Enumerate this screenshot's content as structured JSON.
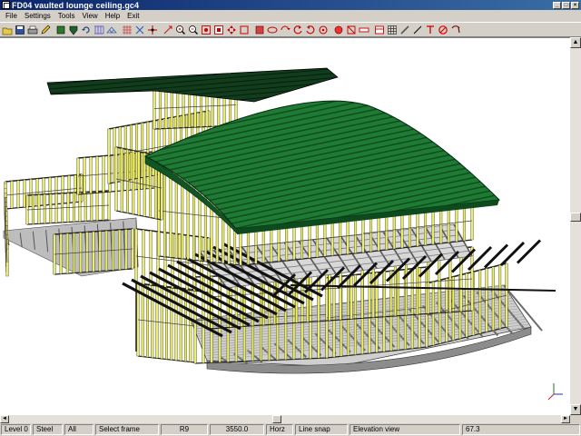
{
  "window": {
    "title": "FD04 vaulted lounge ceiling.gc4",
    "buttons": {
      "minimize": "_",
      "maximize": "□",
      "close": "×"
    }
  },
  "menu": [
    "File",
    "Settings",
    "Tools",
    "View",
    "Help",
    "Exit"
  ],
  "toolbar": {
    "icons": [
      "open-folder-icon",
      "save-icon",
      "print-icon",
      "pencil-icon",
      "layers-icon",
      "shield-icon",
      "undo-icon",
      "wall-frame-icon",
      "truss-icon",
      "floor-grid-icon",
      "paint-icon",
      "move-icon",
      "stretch-icon",
      "zoom-in-icon",
      "zoom-out-icon",
      "zoom-window-icon",
      "zoom-extents-icon",
      "pan-icon",
      "select-box-icon",
      "select-all-icon",
      "view-front-icon",
      "view-side-icon",
      "rotate-left-icon",
      "rotate-right-icon",
      "orbit-icon",
      "redraw-icon",
      "frame-box-icon",
      "measure-icon",
      "panel-icon",
      "grid-icon",
      "bracing-icon",
      "line-icon",
      "text-icon",
      "delete-icon",
      "settings-wrench-icon"
    ]
  },
  "scene": {
    "background": "#ffffff",
    "roof_color": "#1f7a33",
    "wall_color": "#eeee66",
    "floor_color": "#bdbdbd",
    "joist_color": "#111111"
  },
  "status": {
    "level": "Level 0",
    "material": "Steel",
    "filter": "All",
    "mode": "Select frame",
    "code": "R9",
    "value": "3550.0",
    "orientation": "Horz",
    "snap": "Line snap",
    "view": "Elevation view",
    "angle": "67.3"
  }
}
